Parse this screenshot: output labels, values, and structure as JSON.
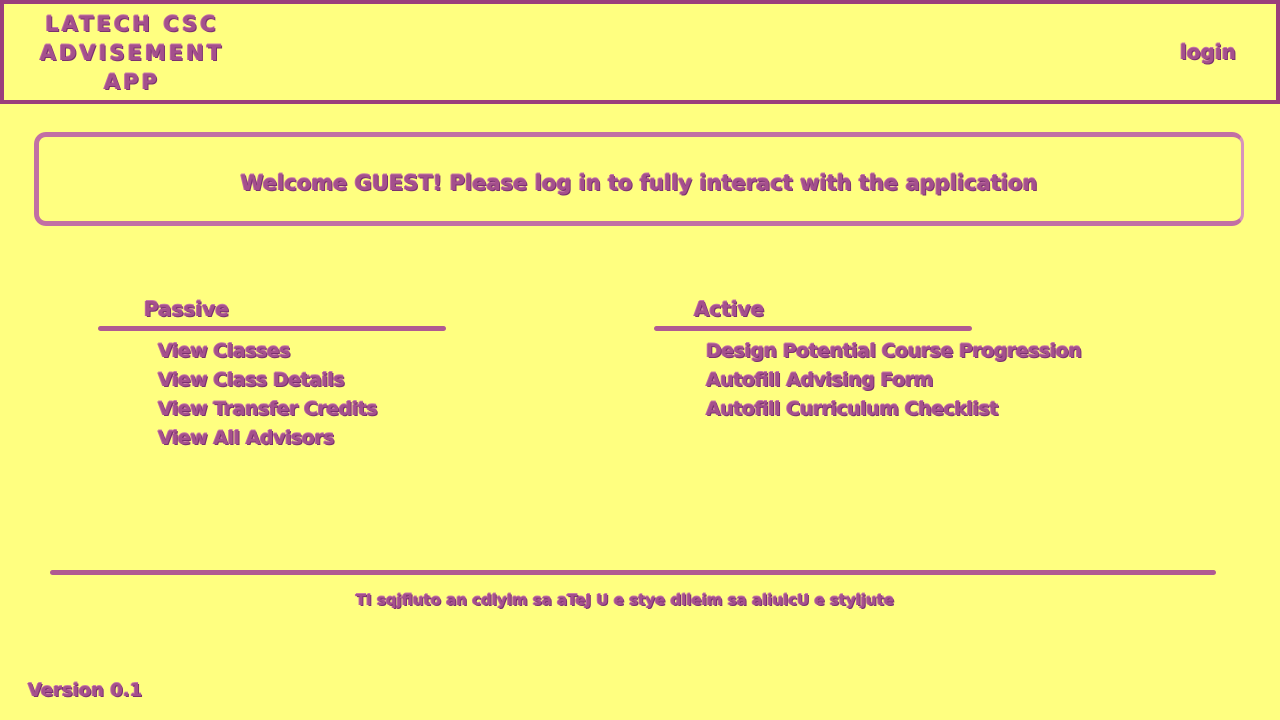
{
  "header": {
    "app_title": "LATECH CSC ADVISEMENT APP",
    "login_label": "login"
  },
  "welcome": {
    "message": "Welcome GUEST! Please log in to fully interact with the application"
  },
  "sections": {
    "passive": {
      "heading": "Passive",
      "items": [
        {
          "label": "View Classes"
        },
        {
          "label": "View Class Details"
        },
        {
          "label": "View Transfer Credits"
        },
        {
          "label": "View All Advisors"
        }
      ]
    },
    "active": {
      "heading": "Active",
      "items": [
        {
          "label": "Design Potential Course Progression"
        },
        {
          "label": "Autofill Advising Form"
        },
        {
          "label": "Autofill Curriculum Checklist"
        }
      ]
    }
  },
  "footer": {
    "text": "TI sqjfluto an cdlylm sa aTeJ U e stye dlleim sa aliulcU e styljute"
  },
  "version": "Version 0.1",
  "colors": {
    "background": "#ffff80",
    "ink": "#a4508c",
    "rule": "#b05a92"
  }
}
